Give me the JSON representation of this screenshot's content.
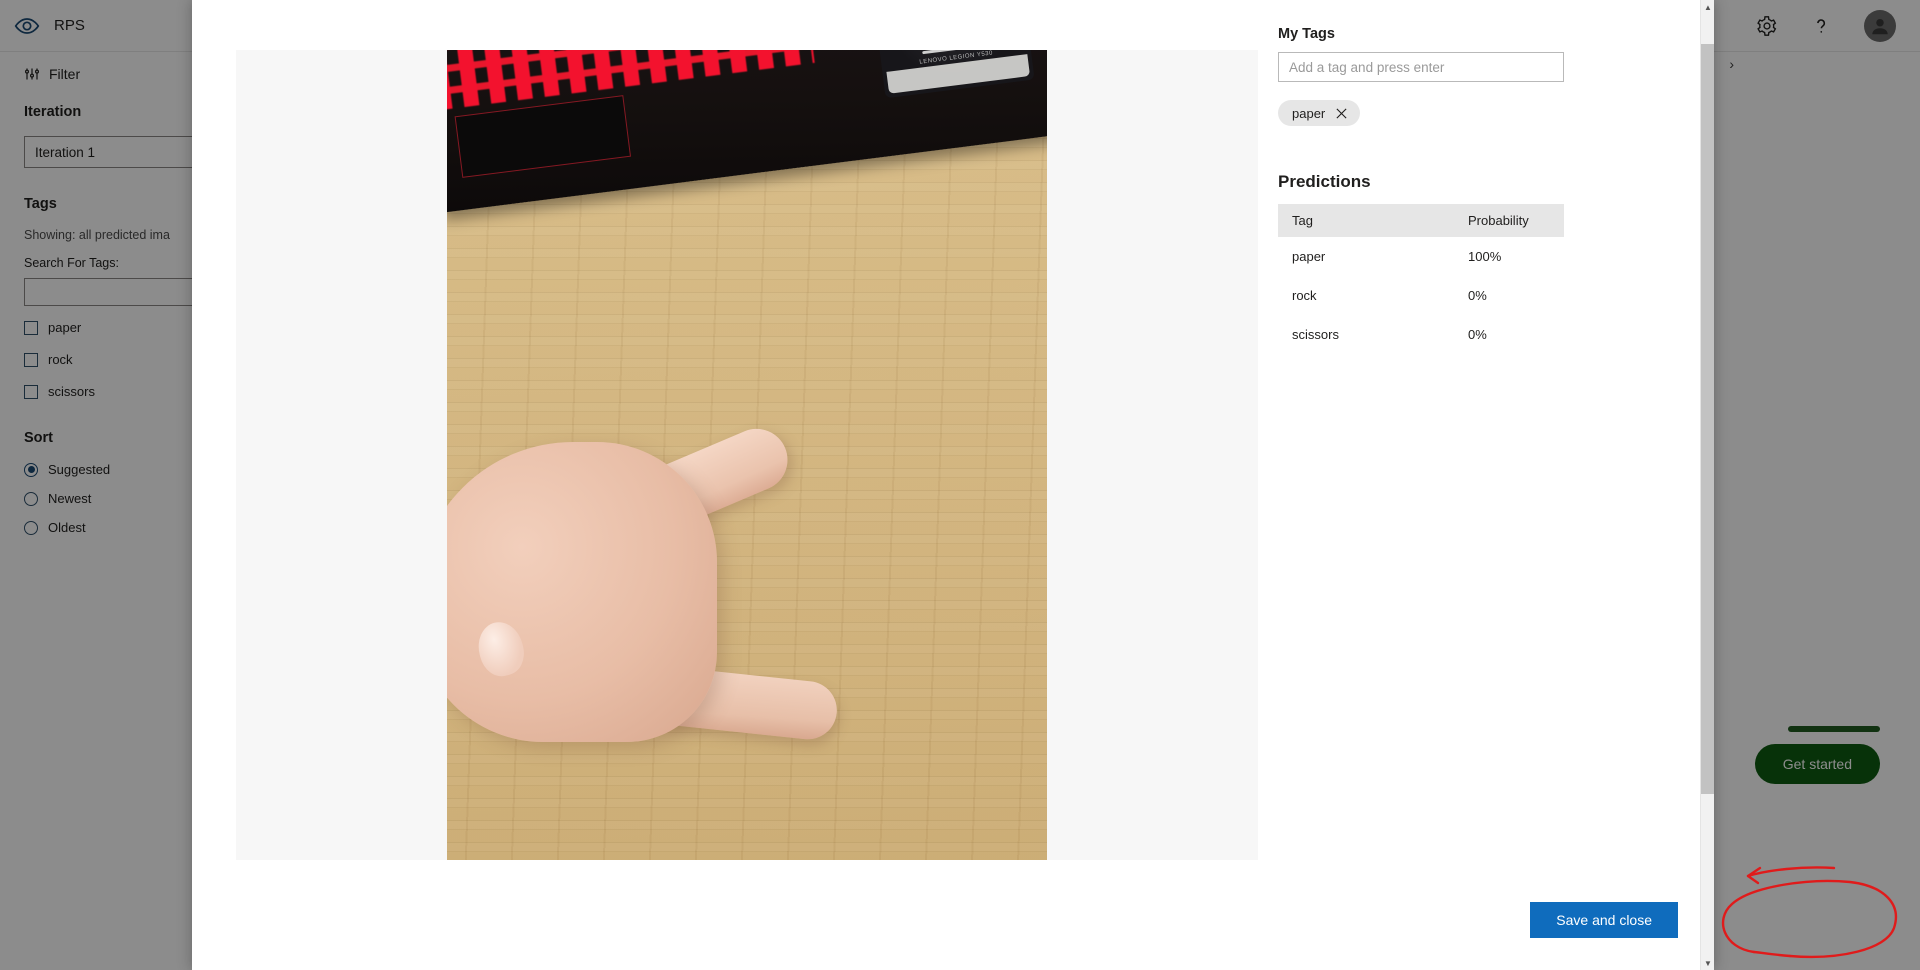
{
  "app": {
    "brand": "RPS",
    "eye_icon": "eye-icon",
    "settings_icon": "gear-icon",
    "help_icon": "help-icon",
    "avatar_icon": "avatar",
    "pager_prev": "‹",
    "pager_next": "›",
    "cta_label": "Get started"
  },
  "sidebar": {
    "filter_label": "Filter",
    "filter_icon": "filter-icon",
    "iteration_heading": "Iteration",
    "iteration_value": "Iteration 1",
    "tags_heading": "Tags",
    "showing_note": "Showing: all predicted ima",
    "search_label": "Search For Tags:",
    "search_value": "",
    "tag_checkboxes": [
      {
        "label": "paper",
        "checked": false
      },
      {
        "label": "rock",
        "checked": false
      },
      {
        "label": "scissors",
        "checked": false
      }
    ],
    "sort_heading": "Sort",
    "sort_options": [
      {
        "label": "Suggested",
        "selected": true
      },
      {
        "label": "Newest",
        "selected": false
      },
      {
        "label": "Oldest",
        "selected": false
      }
    ]
  },
  "modal": {
    "my_tags_heading": "My Tags",
    "tag_input_placeholder": "Add a tag and press enter",
    "tag_input_value": "",
    "assigned_tags": [
      {
        "label": "paper",
        "remove_icon": "close-icon"
      }
    ],
    "predictions_heading": "Predictions",
    "predictions_columns": [
      "Tag",
      "Probability"
    ],
    "predictions_rows": [
      {
        "tag": "paper",
        "probability": "100%"
      },
      {
        "tag": "rock",
        "probability": "0%"
      },
      {
        "tag": "scissors",
        "probability": "0%"
      }
    ],
    "save_button": "Save and close",
    "image_alt": "hand gesture on bamboo desk with lenovo legion laptop",
    "laptop_sticker_text": "LENOVO LEGION Y530"
  },
  "colors": {
    "primary_button": "#0f6cbd",
    "cta_green": "#0e5c11",
    "annotation_red": "#e01b1b",
    "chip_bg": "#e6e6e6",
    "table_header_bg": "#e6e6e6"
  }
}
